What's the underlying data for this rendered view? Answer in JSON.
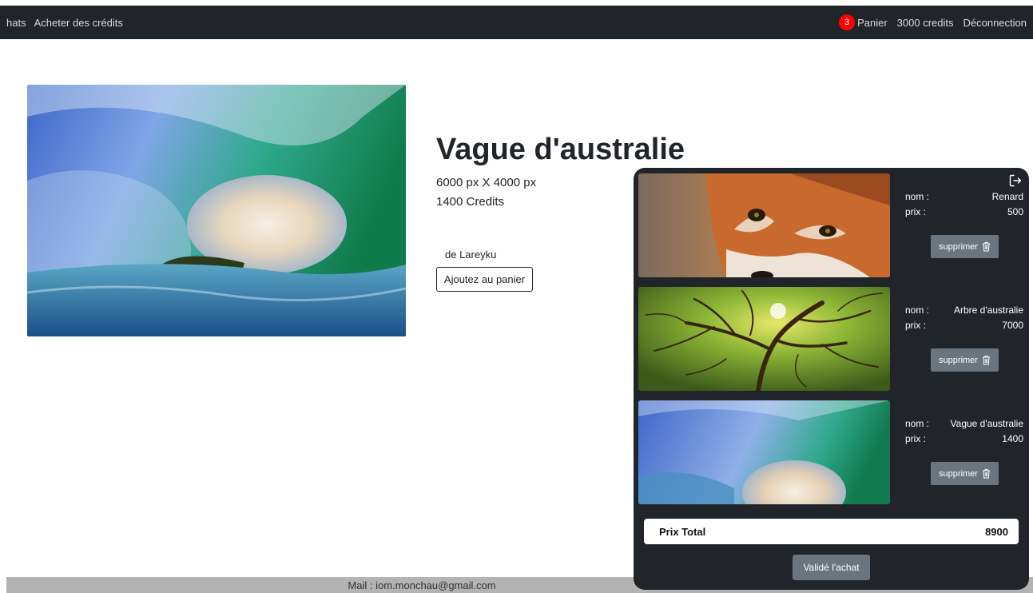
{
  "nav": {
    "left_items": [
      "hats",
      "Acheter des crédits"
    ],
    "cart_count": "3",
    "cart_label": "Panier",
    "credits": "3000 credits",
    "logout": "Déconnection"
  },
  "product": {
    "title": "Vague d'australie",
    "dimensions": "6000 px X 4000 px",
    "price": "1400 Credits",
    "author": "de Lareyku",
    "add_to_cart": "Ajoutez au panier"
  },
  "cart": {
    "close_icon": "exit-icon",
    "items": [
      {
        "name_label": "nom :",
        "name": "Renard",
        "price_label": "prix :",
        "price": "500",
        "remove_label": "supprimer",
        "image": "fox-photo"
      },
      {
        "name_label": "nom :",
        "name": "Arbre d'australie",
        "price_label": "prix :",
        "price": "7000",
        "remove_label": "supprimer",
        "image": "tree-photo"
      },
      {
        "name_label": "nom :",
        "name": "Vague d'australie",
        "price_label": "prix :",
        "price": "1400",
        "remove_label": "supprimer",
        "image": "wave-photo"
      }
    ],
    "total_label": "Prix Total",
    "total_value": "8900",
    "validate": "Validé l'achat"
  },
  "footer": {
    "mail": "Mail : iom.monchau@gmail.com"
  },
  "colors": {
    "navbar_bg": "#212529",
    "badge": "#ff0000",
    "cart_bg": "#212529",
    "button_gray": "#6c757d",
    "footer_bg": "#b3b3b3"
  }
}
